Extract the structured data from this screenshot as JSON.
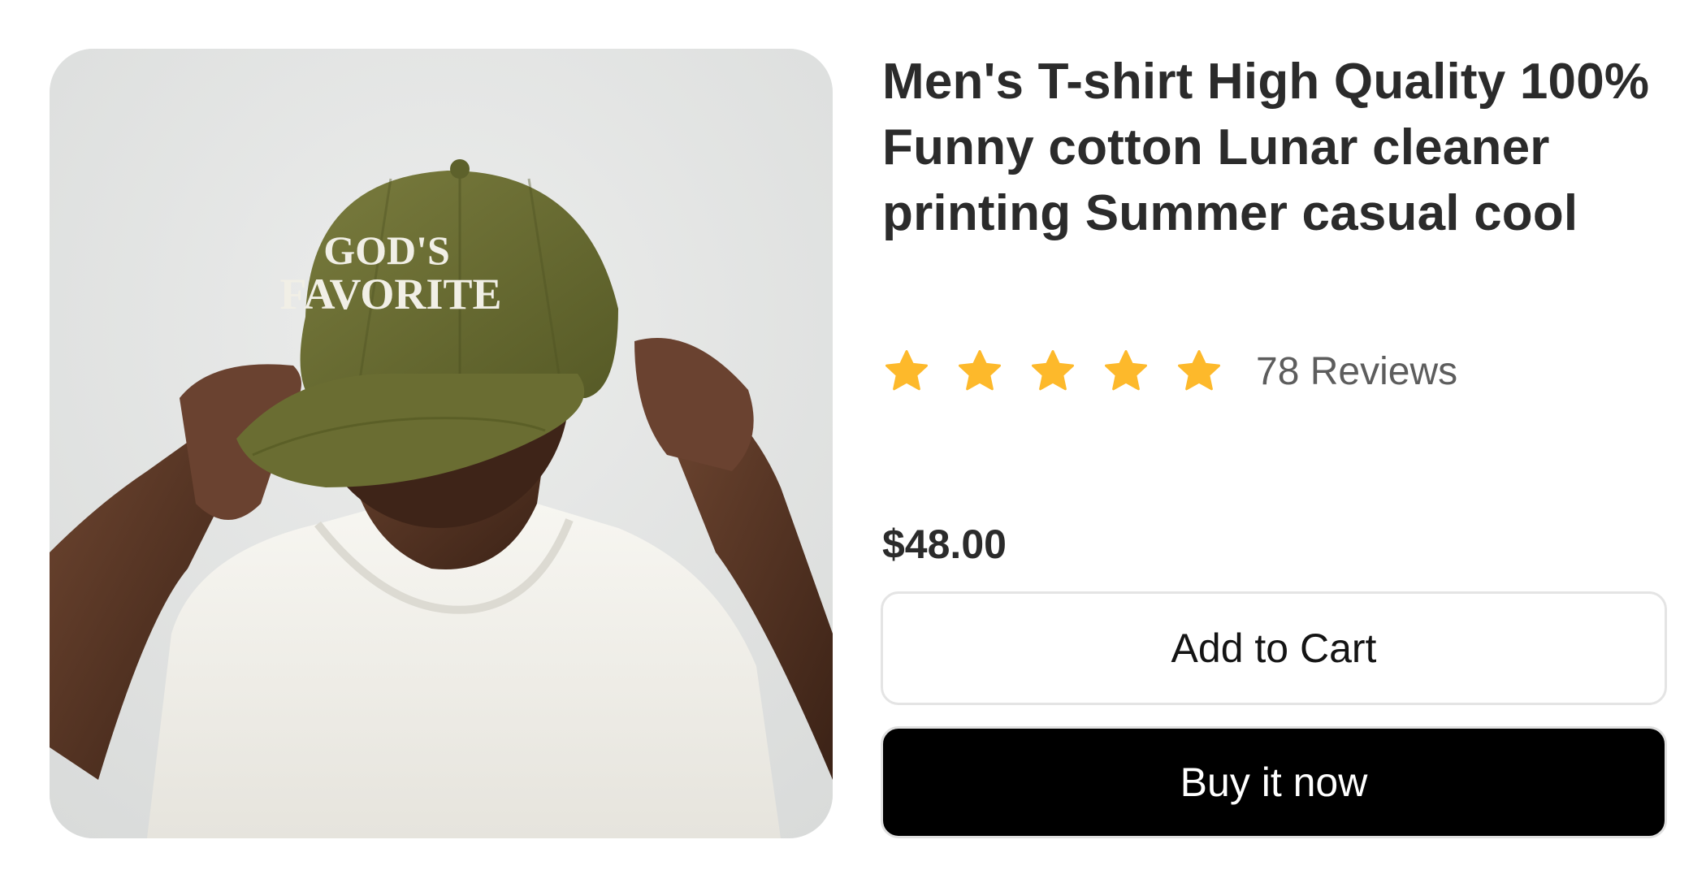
{
  "product": {
    "image": {
      "alt": "",
      "cap_text_line1": "GOD'S",
      "cap_text_line2": "FAVORITE"
    },
    "title": "Men's T-shirt High Quality 100% Funny cotton Lunar cleaner printing Summer casual cool",
    "rating": {
      "value": 5,
      "max": 5,
      "star_icon": "star-icon",
      "star_color": "#FDB92B",
      "reviews_label": "78 Reviews"
    },
    "price": "$48.00",
    "actions": {
      "add_to_cart_label": "Add to Cart",
      "buy_now_label": "Buy it now"
    }
  },
  "colors": {
    "accent": "#000000",
    "text": "#2B2B2B",
    "muted": "#5D5D5D",
    "border": "#E4E4E4"
  }
}
